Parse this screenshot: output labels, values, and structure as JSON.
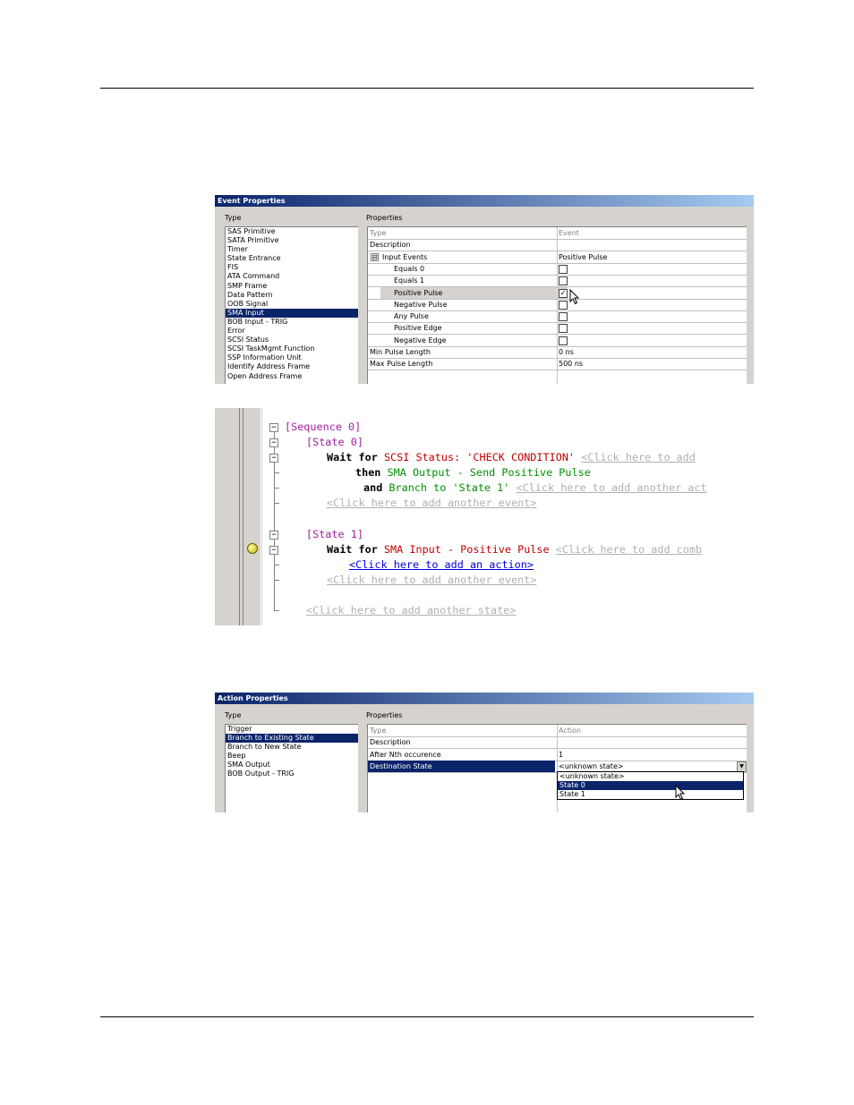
{
  "event_dialog": {
    "title": "Event Properties",
    "type_label": "Type",
    "properties_label": "Properties",
    "types": [
      "SAS Primitive",
      "SATA Primitive",
      "Timer",
      "State Entrance",
      "FIS",
      "ATA Command",
      "SMP Frame",
      "Data Pattern",
      "OOB Signal",
      "SMA Input",
      "BOB Input - TRIG",
      "Error",
      "SCSI Status",
      "SCSI TaskMgmt Function",
      "SSP Information Unit",
      "Identify Address Frame",
      "Open Address Frame"
    ],
    "selected_type_index": 9,
    "rows": [
      {
        "name": "Type",
        "value": "Event"
      },
      {
        "name": "Description",
        "value": ""
      },
      {
        "name": "Input Events",
        "value": "Positive Pulse"
      },
      {
        "name": "Equals 0",
        "value": ""
      },
      {
        "name": "Equals 1",
        "value": ""
      },
      {
        "name": "Positive Pulse",
        "value": ""
      },
      {
        "name": "Negative Pulse",
        "value": ""
      },
      {
        "name": "Any Pulse",
        "value": ""
      },
      {
        "name": "Positive Edge",
        "value": ""
      },
      {
        "name": "Negative Edge",
        "value": ""
      },
      {
        "name": "Min Pulse Length",
        "value": "0 ns"
      },
      {
        "name": "Max Pulse Length",
        "value": "500 ns"
      }
    ],
    "expand_glyph": "⊟",
    "check_glyph": "✓"
  },
  "code": {
    "sequence_0": "[Sequence 0]",
    "state_0": "[State 0]",
    "wait": "Wait",
    "for": "for",
    "event_scsi": "SCSI Status: 'CHECK CONDITION'",
    "ph_comb_1": "<Click here to add",
    "then": "then",
    "action_sma": "SMA Output - Send Positive Pulse",
    "and": "and",
    "action_branch": "Branch to 'State 1'",
    "ph_action_1": "<Click here to add another act",
    "ph_event_1": "<Click here to add another event>",
    "state_1": "[State 1]",
    "wait_2": "Wait",
    "for_2": "for",
    "event_sma": "SMA Input - Positive Pulse",
    "ph_comb_2": "<Click here to add comb",
    "add_action_link": "<Click here to add an action>",
    "ph_event_2": "<Click here to add another event>",
    "ph_state": "<Click here to add another state>"
  },
  "action_dialog": {
    "title": "Action Properties",
    "type_label": "Type",
    "properties_label": "Properties",
    "types": [
      "Trigger",
      "Branch to Existing State",
      "Branch to New State",
      "Beep",
      "SMA Output",
      "BOB Output - TRIG"
    ],
    "selected_type_index": 1,
    "rows": [
      {
        "name": "Type",
        "value": "Action"
      },
      {
        "name": "Description",
        "value": ""
      },
      {
        "name": "After Nth occurence",
        "value": "1"
      },
      {
        "name": "Destination State",
        "value": "<unknown state>"
      }
    ],
    "dropdown_options": [
      "<unknown state>",
      "State 0",
      "State 1"
    ],
    "dropdown_selected_index": 1,
    "dropdown_arrow": "▼"
  }
}
